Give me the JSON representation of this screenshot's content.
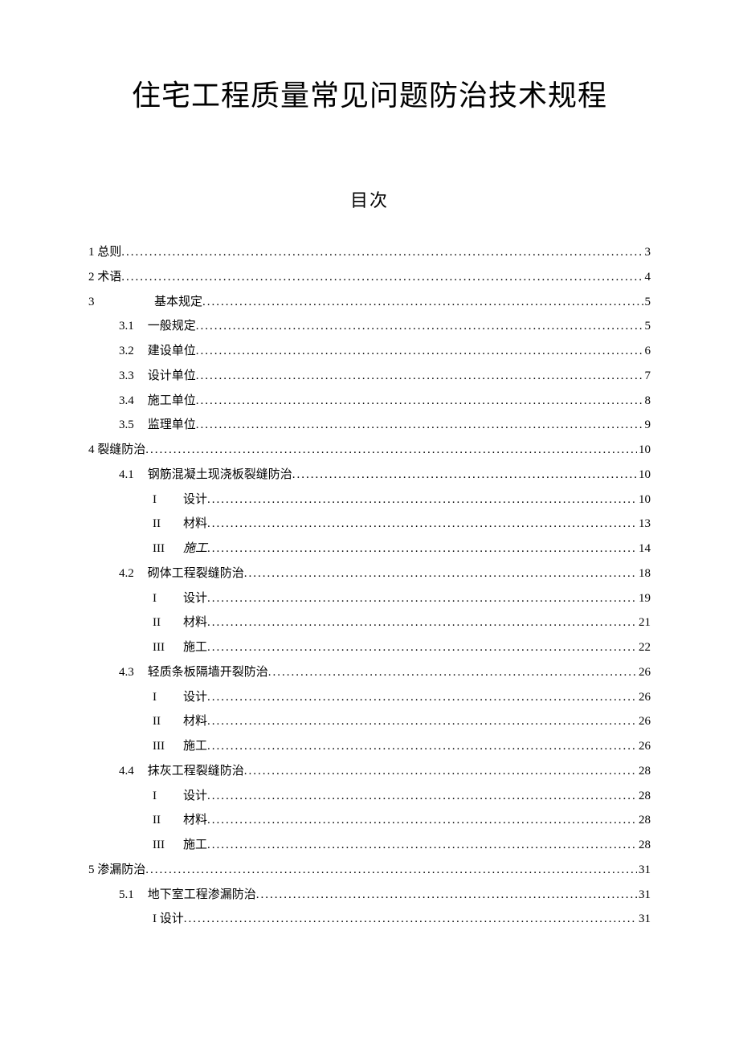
{
  "title": "住宅工程质量常见问题防治技术规程",
  "toc_heading": "目次",
  "toc": [
    {
      "level": 0,
      "num": "1",
      "text": "总则",
      "page": "3"
    },
    {
      "level": 0,
      "num": "2",
      "text": "术语",
      "page": "4"
    },
    {
      "level": 0,
      "num": "3",
      "text": "基本规定",
      "page": "5",
      "wideNum": true
    },
    {
      "level": 1,
      "num": "3.1",
      "text": "一般规定",
      "page": "5"
    },
    {
      "level": 1,
      "num": "3.2",
      "text": "建设单位",
      "page": "6"
    },
    {
      "level": 1,
      "num": "3.3",
      "text": "设计单位",
      "page": "7"
    },
    {
      "level": 1,
      "num": "3.4",
      "text": "施工单位",
      "page": "8"
    },
    {
      "level": 1,
      "num": "3.5",
      "text": "监理单位",
      "page": "9"
    },
    {
      "level": 0,
      "num": "4",
      "text": "裂缝防治",
      "page": "10"
    },
    {
      "level": 1,
      "num": "4.1",
      "text": "钢筋混凝土现浇板裂缝防治",
      "page": "10"
    },
    {
      "level": 2,
      "num": "I",
      "text": "设计",
      "page": "10"
    },
    {
      "level": 2,
      "num": "II",
      "text": "材料",
      "page": "13"
    },
    {
      "level": 2,
      "num": "III",
      "text": "施工",
      "page": "14",
      "italic": true
    },
    {
      "level": 1,
      "num": "4.2",
      "text": "砌体工程裂缝防治",
      "page": "18"
    },
    {
      "level": 2,
      "num": "I",
      "text": "设计",
      "page": "19"
    },
    {
      "level": 2,
      "num": "II",
      "text": "材料",
      "page": "21"
    },
    {
      "level": 2,
      "num": "III",
      "text": "施工",
      "page": "22"
    },
    {
      "level": 1,
      "num": "4.3",
      "text": "轻质条板隔墙开裂防治",
      "page": "26"
    },
    {
      "level": 2,
      "num": "I",
      "text": "设计",
      "page": "26"
    },
    {
      "level": 2,
      "num": "II",
      "text": "材料",
      "page": "26"
    },
    {
      "level": 2,
      "num": "III",
      "text": "施工",
      "page": "26"
    },
    {
      "level": 1,
      "num": "4.4",
      "text": "抹灰工程裂缝防治",
      "page": "28"
    },
    {
      "level": 2,
      "num": "I",
      "text": "设计",
      "page": "28"
    },
    {
      "level": 2,
      "num": "II",
      "text": "材料",
      "page": "28"
    },
    {
      "level": 2,
      "num": "III",
      "text": "施工",
      "page": "28"
    },
    {
      "level": 0,
      "num": "5",
      "text": "渗漏防治",
      "page": "31"
    },
    {
      "level": 1,
      "num": "5.1",
      "text": "地下室工程渗漏防治",
      "page": "31"
    },
    {
      "level": 3,
      "num": "",
      "text": "I 设计",
      "page": "31"
    }
  ]
}
